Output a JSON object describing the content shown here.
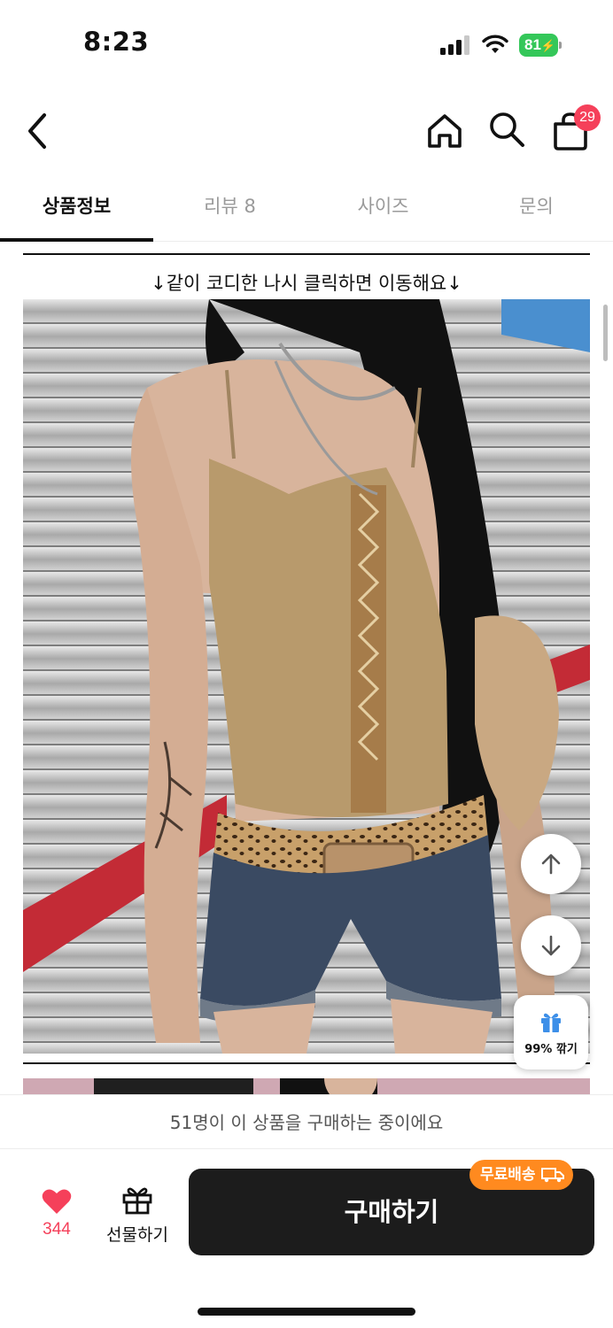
{
  "status": {
    "time": "8:23",
    "battery": "81"
  },
  "header": {
    "cart_count": "29",
    "icons": [
      "back-arrow-icon",
      "home-icon",
      "search-icon",
      "shopping-bag-icon"
    ]
  },
  "tabs": [
    {
      "label": "상품정보",
      "active": true
    },
    {
      "label": "리뷰 8",
      "active": false
    },
    {
      "label": "사이즈",
      "active": false
    },
    {
      "label": "문의",
      "active": false
    }
  ],
  "content": {
    "caption": "↓같이 코디한 나시 클릭하면 이동해요↓",
    "image_description": "Model wearing beige lace-up camisole, leopard belt and denim shorts"
  },
  "float": {
    "coupon_label": "99% 깎기"
  },
  "notice": "51명이 이 상품을 구매하는 중이에요",
  "bottom": {
    "like_count": "344",
    "gift_label": "선물하기",
    "buy_label": "구매하기",
    "shipping_badge": "무료배송"
  },
  "colors": {
    "accent_pink": "#f5405a",
    "buy_button": "#1c1c1c",
    "shipping_orange": "#ff8a1f",
    "battery_green": "#34c759"
  }
}
